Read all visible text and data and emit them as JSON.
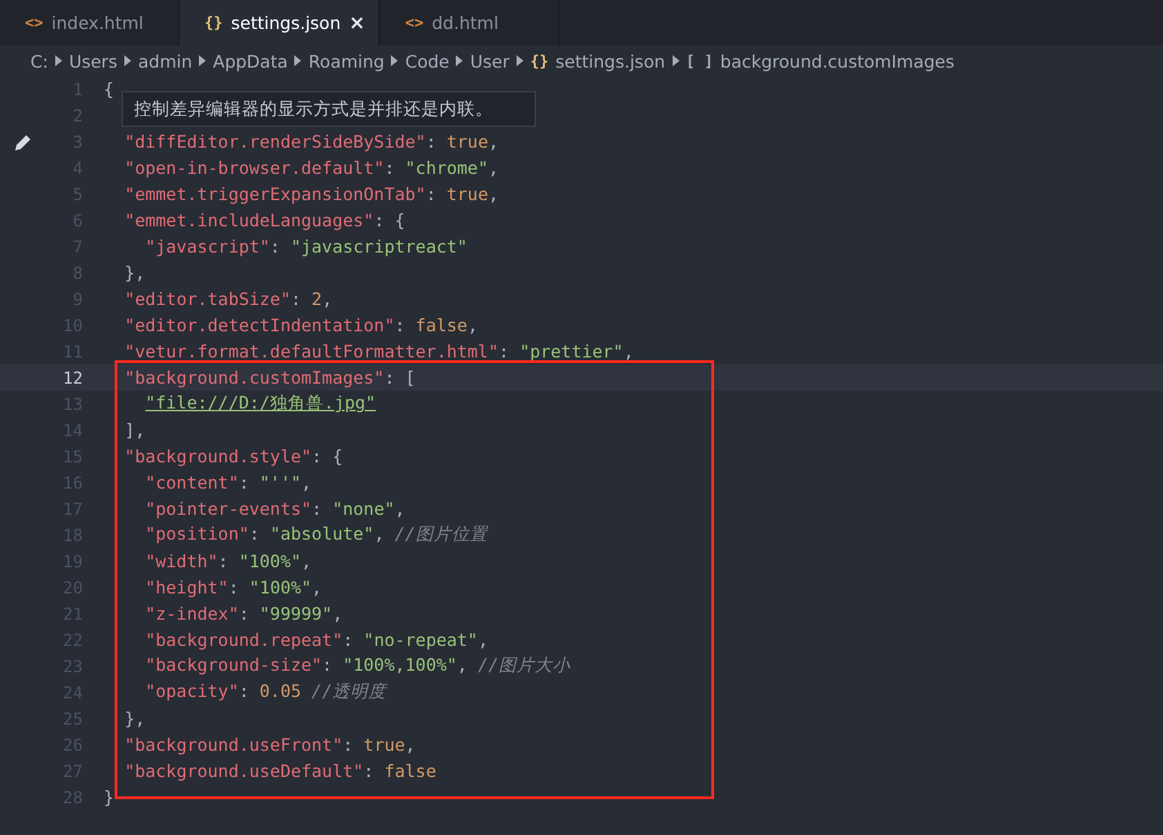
{
  "tabs": [
    {
      "icon": "<>",
      "label": "index.html",
      "selected": false
    },
    {
      "icon": "{}",
      "label": "settings.json",
      "selected": true,
      "close": "×"
    },
    {
      "icon": "<>",
      "label": "dd.html",
      "selected": false
    }
  ],
  "breadcrumb": [
    {
      "label": "C:"
    },
    {
      "label": "Users"
    },
    {
      "label": "admin"
    },
    {
      "label": "AppData"
    },
    {
      "label": "Roaming"
    },
    {
      "label": "Code"
    },
    {
      "label": "User"
    },
    {
      "icon": "{}",
      "label": "settings.json"
    },
    {
      "icon": "[ ]",
      "label": "background.customImages"
    }
  ],
  "hover_tooltip": {
    "text": "控制差异编辑器的显示方式是并排还是内联。"
  },
  "lines": [
    {
      "number": "1",
      "current": false,
      "tokens": [
        {
          "kind": "punct",
          "text": "{"
        }
      ]
    },
    {
      "number": "2",
      "current": false
    },
    {
      "number": "3",
      "current": false,
      "edit_marker": true,
      "tokens": [
        {
          "kind": "key",
          "text": "  \"diffEditor.renderSideBySide\""
        },
        {
          "kind": "punct",
          "text": ": "
        },
        {
          "kind": "literal",
          "text": "true"
        },
        {
          "kind": "punct",
          "text": ","
        }
      ]
    },
    {
      "number": "4",
      "current": false,
      "tokens": [
        {
          "kind": "key",
          "text": "  \"open-in-browser.default\""
        },
        {
          "kind": "punct",
          "text": ": "
        },
        {
          "kind": "string",
          "text": "\"chrome\""
        },
        {
          "kind": "punct",
          "text": ","
        }
      ]
    },
    {
      "number": "5",
      "current": false,
      "tokens": [
        {
          "kind": "key",
          "text": "  \"emmet.triggerExpansionOnTab\""
        },
        {
          "kind": "punct",
          "text": ": "
        },
        {
          "kind": "literal",
          "text": "true"
        },
        {
          "kind": "punct",
          "text": ","
        }
      ]
    },
    {
      "number": "6",
      "current": false,
      "tokens": [
        {
          "kind": "key",
          "text": "  \"emmet.includeLanguages\""
        },
        {
          "kind": "punct",
          "text": ": {"
        }
      ]
    },
    {
      "number": "7",
      "current": false,
      "tokens": [
        {
          "kind": "key",
          "text": "    \"javascript\""
        },
        {
          "kind": "punct",
          "text": ": "
        },
        {
          "kind": "string",
          "text": "\"javascriptreact\""
        }
      ]
    },
    {
      "number": "8",
      "current": false,
      "tokens": [
        {
          "kind": "punct",
          "text": "  },"
        }
      ]
    },
    {
      "number": "9",
      "current": false,
      "tokens": [
        {
          "kind": "key",
          "text": "  \"editor.tabSize\""
        },
        {
          "kind": "punct",
          "text": ": "
        },
        {
          "kind": "literal",
          "text": "2"
        },
        {
          "kind": "punct",
          "text": ","
        }
      ]
    },
    {
      "number": "10",
      "current": false,
      "tokens": [
        {
          "kind": "key",
          "text": "  \"editor.detectIndentation\""
        },
        {
          "kind": "punct",
          "text": ": "
        },
        {
          "kind": "literal",
          "text": "false"
        },
        {
          "kind": "punct",
          "text": ","
        }
      ]
    },
    {
      "number": "11",
      "current": false,
      "tokens": [
        {
          "kind": "key",
          "text": "  \"vetur.format.defaultFormatter.html\""
        },
        {
          "kind": "punct",
          "text": ": "
        },
        {
          "kind": "string",
          "text": "\"prettier\""
        },
        {
          "kind": "punct",
          "text": ","
        }
      ]
    },
    {
      "number": "12",
      "current": true,
      "tokens": [
        {
          "kind": "key",
          "text": "  \"background.customImages\""
        },
        {
          "kind": "punct",
          "text": ": ["
        }
      ]
    },
    {
      "number": "13",
      "current": false,
      "tokens": [
        {
          "kind": "link",
          "text": "    \"file:///D:/独角兽.jpg\""
        }
      ]
    },
    {
      "number": "14",
      "current": false,
      "tokens": [
        {
          "kind": "punct",
          "text": "  ],"
        }
      ]
    },
    {
      "number": "15",
      "current": false,
      "tokens": [
        {
          "kind": "key",
          "text": "  \"background.style\""
        },
        {
          "kind": "punct",
          "text": ": {"
        }
      ]
    },
    {
      "number": "16",
      "current": false,
      "tokens": [
        {
          "kind": "key",
          "text": "    \"content\""
        },
        {
          "kind": "punct",
          "text": ": "
        },
        {
          "kind": "string",
          "text": "\"''\""
        },
        {
          "kind": "punct",
          "text": ","
        }
      ]
    },
    {
      "number": "17",
      "current": false,
      "tokens": [
        {
          "kind": "key",
          "text": "    \"pointer-events\""
        },
        {
          "kind": "punct",
          "text": ": "
        },
        {
          "kind": "string",
          "text": "\"none\""
        },
        {
          "kind": "punct",
          "text": ","
        }
      ]
    },
    {
      "number": "18",
      "current": false,
      "tokens": [
        {
          "kind": "key",
          "text": "    \"position\""
        },
        {
          "kind": "punct",
          "text": ": "
        },
        {
          "kind": "string",
          "text": "\"absolute\""
        },
        {
          "kind": "punct",
          "text": ", "
        },
        {
          "kind": "comment",
          "text": "//图片位置"
        }
      ]
    },
    {
      "number": "19",
      "current": false,
      "tokens": [
        {
          "kind": "key",
          "text": "    \"width\""
        },
        {
          "kind": "punct",
          "text": ": "
        },
        {
          "kind": "string",
          "text": "\"100%\""
        },
        {
          "kind": "punct",
          "text": ","
        }
      ]
    },
    {
      "number": "20",
      "current": false,
      "tokens": [
        {
          "kind": "key",
          "text": "    \"height\""
        },
        {
          "kind": "punct",
          "text": ": "
        },
        {
          "kind": "string",
          "text": "\"100%\""
        },
        {
          "kind": "punct",
          "text": ","
        }
      ]
    },
    {
      "number": "21",
      "current": false,
      "tokens": [
        {
          "kind": "key",
          "text": "    \"z-index\""
        },
        {
          "kind": "punct",
          "text": ": "
        },
        {
          "kind": "string",
          "text": "\"99999\""
        },
        {
          "kind": "punct",
          "text": ","
        }
      ]
    },
    {
      "number": "22",
      "current": false,
      "tokens": [
        {
          "kind": "key",
          "text": "    \"background.repeat\""
        },
        {
          "kind": "punct",
          "text": ": "
        },
        {
          "kind": "string",
          "text": "\"no-repeat\""
        },
        {
          "kind": "punct",
          "text": ","
        }
      ]
    },
    {
      "number": "23",
      "current": false,
      "tokens": [
        {
          "kind": "key",
          "text": "    \"background-size\""
        },
        {
          "kind": "punct",
          "text": ": "
        },
        {
          "kind": "string",
          "text": "\"100%,100%\""
        },
        {
          "kind": "punct",
          "text": ", "
        },
        {
          "kind": "comment",
          "text": "//图片大小"
        }
      ]
    },
    {
      "number": "24",
      "current": false,
      "tokens": [
        {
          "kind": "key",
          "text": "    \"opacity\""
        },
        {
          "kind": "punct",
          "text": ": "
        },
        {
          "kind": "literal",
          "text": "0.05"
        },
        {
          "kind": "comment",
          "text": " //透明度"
        }
      ]
    },
    {
      "number": "25",
      "current": false,
      "tokens": [
        {
          "kind": "punct",
          "text": "  },"
        }
      ]
    },
    {
      "number": "26",
      "current": false,
      "tokens": [
        {
          "kind": "key",
          "text": "  \"background.useFront\""
        },
        {
          "kind": "punct",
          "text": ": "
        },
        {
          "kind": "literal",
          "text": "true"
        },
        {
          "kind": "punct",
          "text": ","
        }
      ]
    },
    {
      "number": "27",
      "current": false,
      "tokens": [
        {
          "kind": "key",
          "text": "  \"background.useDefault\""
        },
        {
          "kind": "punct",
          "text": ": "
        },
        {
          "kind": "literal",
          "text": "false"
        }
      ]
    },
    {
      "number": "28",
      "current": false,
      "tokens": [
        {
          "kind": "punct",
          "text": "}"
        }
      ]
    }
  ]
}
